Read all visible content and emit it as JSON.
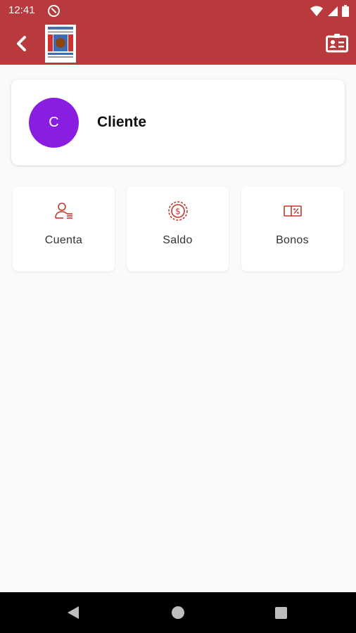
{
  "status_bar": {
    "time": "12:41"
  },
  "profile": {
    "avatar_letter": "C",
    "name": "Cliente"
  },
  "tiles": [
    {
      "label": "Cuenta",
      "icon": "account-user-icon"
    },
    {
      "label": "Saldo",
      "icon": "balance-coin-icon"
    },
    {
      "label": "Bonos",
      "icon": "voucher-icon"
    }
  ],
  "colors": {
    "primary": "#b83a3d",
    "avatar": "#8a1ee0",
    "background": "#fafafa",
    "icon_accent": "#c0392b"
  }
}
